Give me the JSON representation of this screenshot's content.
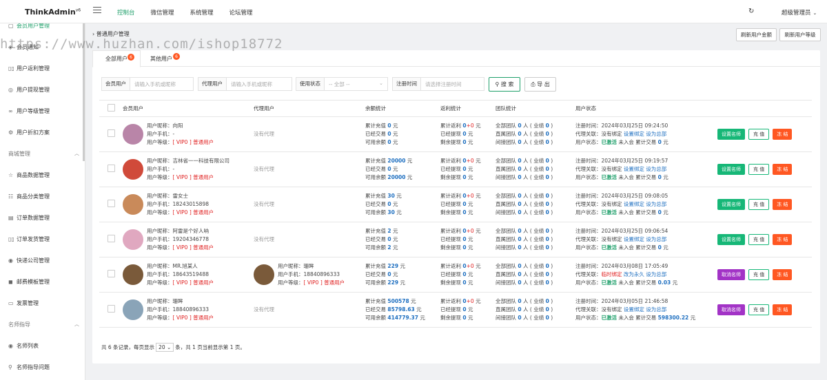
{
  "brand": {
    "name": "ThinkAdmin",
    "version": "v6"
  },
  "topnav": [
    "控制台",
    "微信管理",
    "系统管理",
    "论坛管理"
  ],
  "topnav_active": 0,
  "header": {
    "user": "超级管理员",
    "user_caret": "⌄",
    "refresh_icon": "↻"
  },
  "sidebar": {
    "items": [
      {
        "label": "会员用户管理",
        "icon": "▢",
        "active": true,
        "y": 0
      },
      {
        "label": "会员通知",
        "icon": "◈",
        "y": 1
      },
      {
        "label": "用户返利管理",
        "icon": "▯▯",
        "y": 2
      },
      {
        "label": "用户提现管理",
        "icon": "◎",
        "y": 3
      },
      {
        "label": "用户等级管理",
        "icon": "∞",
        "y": 4
      },
      {
        "label": "用户折扣方案",
        "icon": "⚙",
        "y": 5
      }
    ],
    "groups": [
      {
        "label": "商城管理",
        "arrow": "︿"
      },
      {
        "label": "名师指导",
        "arrow": "︿"
      }
    ],
    "shop_items": [
      {
        "label": "商品数据管理",
        "icon": "☆"
      },
      {
        "label": "商品分类管理",
        "icon": "☷"
      },
      {
        "label": "订单数据管理",
        "icon": "▤"
      },
      {
        "label": "订单发货管理",
        "icon": "▯▯"
      },
      {
        "label": "快递公司管理",
        "icon": "◉"
      },
      {
        "label": "邮费模板管理",
        "icon": "◼"
      },
      {
        "label": "发票管理",
        "icon": "▭"
      }
    ],
    "teacher_items": [
      {
        "label": "名师列表",
        "icon": "◉"
      },
      {
        "label": "名师指导问题",
        "icon": "⚲"
      }
    ]
  },
  "breadcrumb": "普通用户管理",
  "toolbar": {
    "refresh_amount": "刷新用户金额",
    "refresh_level": "刷新用户等级"
  },
  "watermark": "https://www.huzhan.com/ishop18772",
  "tabs": [
    {
      "label": "全部用户",
      "badge": "6"
    },
    {
      "label": "其他用户",
      "badge": "6"
    }
  ],
  "filters": {
    "member_label": "会员用户",
    "member_ph": "请输入手机或昵称",
    "agent_label": "代理用户",
    "agent_ph": "请输入手机或昵称",
    "status_label": "使用状态",
    "status_ph": "-- 全部 --",
    "reg_label": "注册时间",
    "reg_ph": "请选择注册时间",
    "search": "搜 索",
    "export": "导 出"
  },
  "columns": [
    "会员用户",
    "代理用户",
    "余额统计",
    "返利统计",
    "团队统计",
    "用户状态"
  ],
  "rows": [
    {
      "nick": "向阳",
      "phone": "-",
      "level": "VIP0",
      "level_name": "普通用户",
      "agent": "没有代理",
      "recharge": "0",
      "traded": "0",
      "avail": "0",
      "rebate": "0",
      "rebate_plus": "0",
      "rebate_done": "0",
      "rebate_left": "0",
      "team_all": "0",
      "team_all_perf": "0",
      "team_direct": "0",
      "team_direct_perf": "0",
      "team_indirect": "0",
      "team_indirect_perf": "0",
      "reg_time": "2024年03月25日 09:24:50",
      "agent_rel": "没有绑定",
      "bind": "设置绑定",
      "set_master": "设为总部",
      "status": "已激活",
      "joined": "未入会",
      "trade": "0",
      "btn_teacher": "设置名师",
      "btn_recharge": "充 值",
      "btn_freeze": "冻 结",
      "teacher_on": true,
      "avatar_color": "#b985a8"
    },
    {
      "nick": "吉林省一一科技有限公司",
      "phone": "-",
      "level": "VIP0",
      "level_name": "普通用户",
      "agent": "没有代理",
      "recharge": "20000",
      "traded": "0",
      "avail": "20000",
      "rebate": "0",
      "rebate_plus": "0",
      "rebate_done": "0",
      "rebate_left": "0",
      "team_all": "0",
      "team_all_perf": "0",
      "team_direct": "0",
      "team_direct_perf": "0",
      "team_indirect": "0",
      "team_indirect_perf": "0",
      "reg_time": "2024年03月25日 09:19:57",
      "agent_rel": "没有绑定",
      "bind": "设置绑定",
      "set_master": "设为总部",
      "status": "已激活",
      "joined": "未入会",
      "trade": "0",
      "btn_teacher": "设置名师",
      "btn_recharge": "充 值",
      "btn_freeze": "冻 结",
      "teacher_on": true,
      "avatar_color": "#d04a3a"
    },
    {
      "nick": "雷女士",
      "phone": "18243015898",
      "level": "VIP0",
      "level_name": "普通用户",
      "agent": "没有代理",
      "recharge": "30",
      "traded": "0",
      "avail": "30",
      "rebate": "0",
      "rebate_plus": "0",
      "rebate_done": "0",
      "rebate_left": "0",
      "team_all": "0",
      "team_all_perf": "0",
      "team_direct": "0",
      "team_direct_perf": "0",
      "team_indirect": "0",
      "team_indirect_perf": "0",
      "reg_time": "2024年03月25日 09:08:05",
      "agent_rel": "没有绑定",
      "bind": "设置绑定",
      "set_master": "设为总部",
      "status": "已激活",
      "joined": "未入会",
      "trade": "0",
      "btn_teacher": "设置名师",
      "btn_recharge": "充 值",
      "btn_freeze": "冻 结",
      "teacher_on": true,
      "avatar_color": "#c98a5a"
    },
    {
      "nick": "阿雷是个好人呐",
      "phone": "19204346778",
      "level": "VIP0",
      "level_name": "普通用户",
      "agent": "没有代理",
      "recharge": "2",
      "traded": "0",
      "avail": "2",
      "rebate": "0",
      "rebate_plus": "0",
      "rebate_done": "0",
      "rebate_left": "0",
      "team_all": "0",
      "team_all_perf": "0",
      "team_direct": "0",
      "team_direct_perf": "0",
      "team_indirect": "0",
      "team_indirect_perf": "0",
      "reg_time": "2024年03月25日 09:06:54",
      "agent_rel": "没有绑定",
      "bind": "设置绑定",
      "set_master": "设为总部",
      "status": "已激活",
      "joined": "未入会",
      "trade": "0",
      "btn_teacher": "设置名师",
      "btn_recharge": "充 值",
      "btn_freeze": "冻 结",
      "teacher_on": true,
      "avatar_color": "#e0a8c0"
    },
    {
      "nick": "MR.旭某人",
      "phone": "18643519488",
      "level": "VIP0",
      "level_name": "普通用户",
      "agent_nick": "珊眸",
      "agent_phone": "18840896333",
      "agent_level": "VIP0",
      "agent_level_name": "普通用户",
      "recharge": "229",
      "traded": "0",
      "avail": "229",
      "rebate": "0",
      "rebate_plus": "0",
      "rebate_done": "0",
      "rebate_left": "0",
      "team_all": "0",
      "team_all_perf": "0",
      "team_direct": "0",
      "team_direct_perf": "0",
      "team_indirect": "0",
      "team_indirect_perf": "0",
      "reg_time": "2024年03月08日 17:05:49",
      "agent_rel": "临时绑定",
      "bind": "改为永久",
      "set_master": "设为总部",
      "status": "已激活",
      "joined": "未入会",
      "trade": "0.03",
      "btn_teacher": "取消名师",
      "btn_recharge": "充 值",
      "btn_freeze": "冻 结",
      "teacher_on": false,
      "avatar_color": "#7a5a3a"
    },
    {
      "nick": "珊眸",
      "phone": "18840896333",
      "level": "VIP0",
      "level_name": "普通用户",
      "agent": "没有代理",
      "recharge": "500578",
      "traded": "85798.63",
      "avail": "414779.37",
      "rebate": "0",
      "rebate_plus": "0",
      "rebate_done": "0",
      "rebate_left": "0",
      "team_all": "0",
      "team_all_perf": "0",
      "team_direct": "0",
      "team_direct_perf": "0",
      "team_indirect": "0",
      "team_indirect_perf": "0",
      "reg_time": "2024年03月05日 21:46:58",
      "agent_rel": "没有绑定",
      "bind": "设置绑定",
      "set_master": "设为总部",
      "status": "已激活",
      "joined": "未入会",
      "trade": "598300.22",
      "btn_teacher": "取消名师",
      "btn_recharge": "充 值",
      "btn_freeze": "冻 结",
      "teacher_on": false,
      "avatar_color": "#8aa4b8"
    }
  ],
  "labels": {
    "nick": "用户昵称：",
    "phone": "用户手机：",
    "level": "用户等级：",
    "recharge": "累计充值",
    "traded": "已经交易",
    "avail": "可用余额",
    "rebate": "累计返利",
    "rebate_done": "已经提现",
    "rebate_left": "剩余提现",
    "team_all": "全部团队",
    "team_direct": "直属团队",
    "team_indirect": "间接团队",
    "reg_time": "注册时间：",
    "agent_rel": "代理关联：",
    "status": "用户状态：",
    "unit_yuan": "元",
    "unit_people": "人",
    "perf": "业绩",
    "trade": "累计交易"
  },
  "footer": {
    "prefix": "共 6 条记录，每页显示",
    "page_size": "20",
    "suffix": "条，共 1 页当前显示第 1 页。"
  }
}
